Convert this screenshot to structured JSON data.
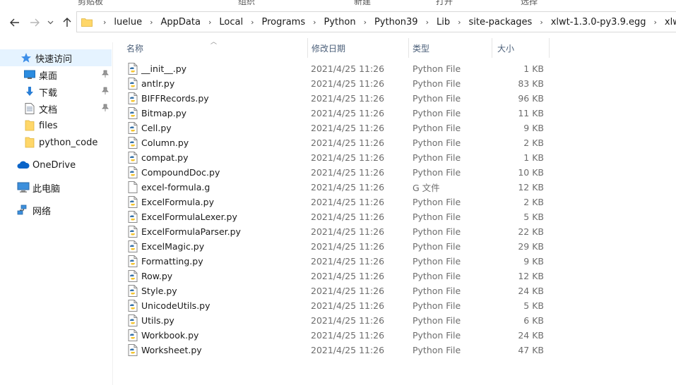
{
  "ribbon": {
    "items": [
      "剪贴板",
      "组织",
      "新建",
      "打开",
      "选择"
    ]
  },
  "nav": {
    "breadcrumbs": [
      "luelue",
      "AppData",
      "Local",
      "Programs",
      "Python",
      "Python39",
      "Lib",
      "site-packages",
      "xlwt-1.3.0-py3.9.egg",
      "xlwt"
    ]
  },
  "sidebar": {
    "items": [
      {
        "label": "快速访问",
        "icon": "star-icon",
        "pinned": false,
        "selected": true
      },
      {
        "label": "桌面",
        "icon": "desktop-icon",
        "pinned": true
      },
      {
        "label": "下载",
        "icon": "download-icon",
        "pinned": true
      },
      {
        "label": "文档",
        "icon": "document-icon",
        "pinned": true
      },
      {
        "label": "files",
        "icon": "folder-icon",
        "pinned": false
      },
      {
        "label": "python_code",
        "icon": "folder-icon",
        "pinned": false
      },
      {
        "label": "OneDrive",
        "icon": "cloud-icon",
        "pinned": false
      },
      {
        "label": "此电脑",
        "icon": "computer-icon",
        "pinned": false
      },
      {
        "label": "网络",
        "icon": "network-icon",
        "pinned": false
      }
    ]
  },
  "columns": {
    "name": "名称",
    "date": "修改日期",
    "type": "类型",
    "size": "大小"
  },
  "files": [
    {
      "name": "__init__.py",
      "date": "2021/4/25 11:26",
      "type": "Python File",
      "size": "1 KB",
      "icon": "python-file-icon"
    },
    {
      "name": "antlr.py",
      "date": "2021/4/25 11:26",
      "type": "Python File",
      "size": "83 KB",
      "icon": "python-file-icon"
    },
    {
      "name": "BIFFRecords.py",
      "date": "2021/4/25 11:26",
      "type": "Python File",
      "size": "96 KB",
      "icon": "python-file-icon"
    },
    {
      "name": "Bitmap.py",
      "date": "2021/4/25 11:26",
      "type": "Python File",
      "size": "11 KB",
      "icon": "python-file-icon"
    },
    {
      "name": "Cell.py",
      "date": "2021/4/25 11:26",
      "type": "Python File",
      "size": "9 KB",
      "icon": "python-file-icon"
    },
    {
      "name": "Column.py",
      "date": "2021/4/25 11:26",
      "type": "Python File",
      "size": "2 KB",
      "icon": "python-file-icon"
    },
    {
      "name": "compat.py",
      "date": "2021/4/25 11:26",
      "type": "Python File",
      "size": "1 KB",
      "icon": "python-file-icon"
    },
    {
      "name": "CompoundDoc.py",
      "date": "2021/4/25 11:26",
      "type": "Python File",
      "size": "10 KB",
      "icon": "python-file-icon"
    },
    {
      "name": "excel-formula.g",
      "date": "2021/4/25 11:26",
      "type": "G 文件",
      "size": "12 KB",
      "icon": "generic-file-icon"
    },
    {
      "name": "ExcelFormula.py",
      "date": "2021/4/25 11:26",
      "type": "Python File",
      "size": "2 KB",
      "icon": "python-file-icon"
    },
    {
      "name": "ExcelFormulaLexer.py",
      "date": "2021/4/25 11:26",
      "type": "Python File",
      "size": "5 KB",
      "icon": "python-file-icon"
    },
    {
      "name": "ExcelFormulaParser.py",
      "date": "2021/4/25 11:26",
      "type": "Python File",
      "size": "22 KB",
      "icon": "python-file-icon"
    },
    {
      "name": "ExcelMagic.py",
      "date": "2021/4/25 11:26",
      "type": "Python File",
      "size": "29 KB",
      "icon": "python-file-icon"
    },
    {
      "name": "Formatting.py",
      "date": "2021/4/25 11:26",
      "type": "Python File",
      "size": "9 KB",
      "icon": "python-file-icon"
    },
    {
      "name": "Row.py",
      "date": "2021/4/25 11:26",
      "type": "Python File",
      "size": "12 KB",
      "icon": "python-file-icon"
    },
    {
      "name": "Style.py",
      "date": "2021/4/25 11:26",
      "type": "Python File",
      "size": "24 KB",
      "icon": "python-file-icon"
    },
    {
      "name": "UnicodeUtils.py",
      "date": "2021/4/25 11:26",
      "type": "Python File",
      "size": "5 KB",
      "icon": "python-file-icon"
    },
    {
      "name": "Utils.py",
      "date": "2021/4/25 11:26",
      "type": "Python File",
      "size": "6 KB",
      "icon": "python-file-icon"
    },
    {
      "name": "Workbook.py",
      "date": "2021/4/25 11:26",
      "type": "Python File",
      "size": "24 KB",
      "icon": "python-file-icon"
    },
    {
      "name": "Worksheet.py",
      "date": "2021/4/25 11:26",
      "type": "Python File",
      "size": "47 KB",
      "icon": "python-file-icon"
    }
  ],
  "colors": {
    "selection": "#e5f3ff",
    "header_text": "#4c607a",
    "secondary_text": "#6d6d6d",
    "folder_yellow": "#ffd769",
    "accent_blue": "#0078d7"
  }
}
